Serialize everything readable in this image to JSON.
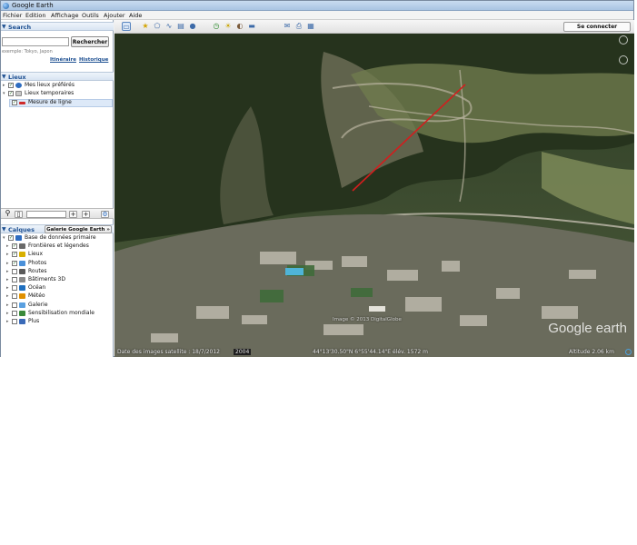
{
  "window": {
    "title": "Google Earth"
  },
  "menu": [
    "Fichier",
    "Edition",
    "Affichage",
    "Outils",
    "Ajouter",
    "Aide"
  ],
  "toolbar": {
    "connect_label": "Se connecter"
  },
  "search": {
    "header": "Search",
    "input_value": "",
    "button_label": "Rechercher",
    "example": "exemple: Tokyo, Japon",
    "itinerary_link": "Itinéraire",
    "history_link": "Historique"
  },
  "places": {
    "header": "Lieux",
    "items": [
      {
        "label": "Mes lieux préférés",
        "checked": true
      },
      {
        "label": "Lieux temporaires",
        "checked": true
      },
      {
        "label": "Mesure de ligne",
        "checked": true,
        "selected": true
      }
    ]
  },
  "layers": {
    "header": "Calques",
    "gallery_button": "Galerie Google Earth",
    "gallery_arrow": "»",
    "items": [
      {
        "label": "Base de données primaire",
        "checked": true
      },
      {
        "label": "Frontières et légendes",
        "checked": true
      },
      {
        "label": "Lieux",
        "checked": true
      },
      {
        "label": "Photos",
        "checked": true
      },
      {
        "label": "Routes",
        "checked": false
      },
      {
        "label": "Bâtiments 3D",
        "checked": false
      },
      {
        "label": "Océan",
        "checked": false
      },
      {
        "label": "Météo",
        "checked": false
      },
      {
        "label": "Galerie",
        "checked": false
      },
      {
        "label": "Sensibilisation mondiale",
        "checked": false
      },
      {
        "label": "Plus",
        "checked": false
      }
    ]
  },
  "map": {
    "imagery_date": "Date des images satellite : 18/7/2012",
    "year_badge": "2004",
    "coordinates": "44°13'30.50\"N   6°55'44.14\"E  élév. 1572 m",
    "altitude": "Altitude   2.06 km",
    "watermark": "Google earth",
    "copyright": "Image © 2013 DigitalGlobe"
  },
  "colors": {
    "measure_line": "#d21e1e",
    "title_accent": "#1d4f91"
  }
}
